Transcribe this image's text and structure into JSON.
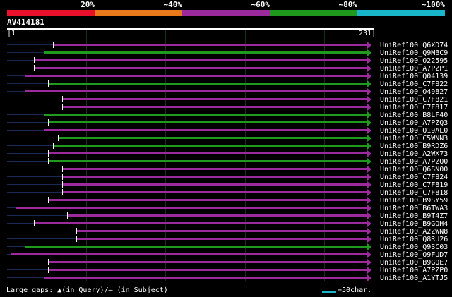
{
  "legend": {
    "labels": [
      "20%",
      "~40%",
      "~60%",
      "~80%",
      "~100%"
    ],
    "colors": [
      "#e8102a",
      "#e87a1c",
      "#9b2a9c",
      "#1f9a1f",
      "#19b5c8"
    ]
  },
  "query": {
    "name": "AV414181",
    "start": "1",
    "end": "231"
  },
  "hits": [
    {
      "id": "UniRef100_Q6XD74",
      "color": "#9b2a9c"
    },
    {
      "id": "UniRef100_Q9MBC9",
      "color": "#1f9a1f"
    },
    {
      "id": "UniRef100_O22595",
      "color": "#9b2a9c"
    },
    {
      "id": "UniRef100_A7PZP1",
      "color": "#9b2a9c"
    },
    {
      "id": "UniRef100_Q04139",
      "color": "#9b2a9c"
    },
    {
      "id": "UniRef100_C7F822",
      "color": "#1f9a1f"
    },
    {
      "id": "UniRef100_O49827",
      "color": "#9b2a9c"
    },
    {
      "id": "UniRef100_C7F821",
      "color": "#9b2a9c"
    },
    {
      "id": "UniRef100_C7F817",
      "color": "#9b2a9c"
    },
    {
      "id": "UniRef100_B8LF40",
      "color": "#1f9a1f"
    },
    {
      "id": "UniRef100_A7PZQ3",
      "color": "#1f9a1f"
    },
    {
      "id": "UniRef100_Q19AL0",
      "color": "#9b2a9c"
    },
    {
      "id": "UniRef100_C5WNN3",
      "color": "#1f9a1f"
    },
    {
      "id": "UniRef100_B9RDZ6",
      "color": "#1f9a1f"
    },
    {
      "id": "UniRef100_A2WX73",
      "color": "#9b2a9c"
    },
    {
      "id": "UniRef100_A7PZQ0",
      "color": "#1f9a1f"
    },
    {
      "id": "UniRef100_Q6SN00",
      "color": "#9b2a9c"
    },
    {
      "id": "UniRef100_C7F824",
      "color": "#9b2a9c"
    },
    {
      "id": "UniRef100_C7F819",
      "color": "#9b2a9c"
    },
    {
      "id": "UniRef100_C7F818",
      "color": "#9b2a9c"
    },
    {
      "id": "UniRef100_B9SY59",
      "color": "#9b2a9c"
    },
    {
      "id": "UniRef100_B6TWA3",
      "color": "#9b2a9c"
    },
    {
      "id": "UniRef100_B9T4Z7",
      "color": "#9b2a9c"
    },
    {
      "id": "UniRef100_B9GQH4",
      "color": "#9b2a9c"
    },
    {
      "id": "UniRef100_A2ZWN8",
      "color": "#9b2a9c"
    },
    {
      "id": "UniRef100_Q8RU26",
      "color": "#9b2a9c"
    },
    {
      "id": "UniRef100_Q9SC03",
      "color": "#1f9a1f"
    },
    {
      "id": "UniRef100_Q9FUD7",
      "color": "#9b2a9c"
    },
    {
      "id": "UniRef100_B9GQE7",
      "color": "#9b2a9c"
    },
    {
      "id": "UniRef100_A7PZP0",
      "color": "#9b2a9c"
    },
    {
      "id": "UniRef100_A1YTJ5",
      "color": "#9b2a9c"
    }
  ],
  "footer": {
    "gaps_label": "Large gaps:",
    "query_gap_symbol": "▲",
    "query_gap_text": "(in Query)/",
    "subject_gap_symbol": "–",
    "subject_gap_text": " (in Subject)",
    "scale_label": "=50char."
  }
}
